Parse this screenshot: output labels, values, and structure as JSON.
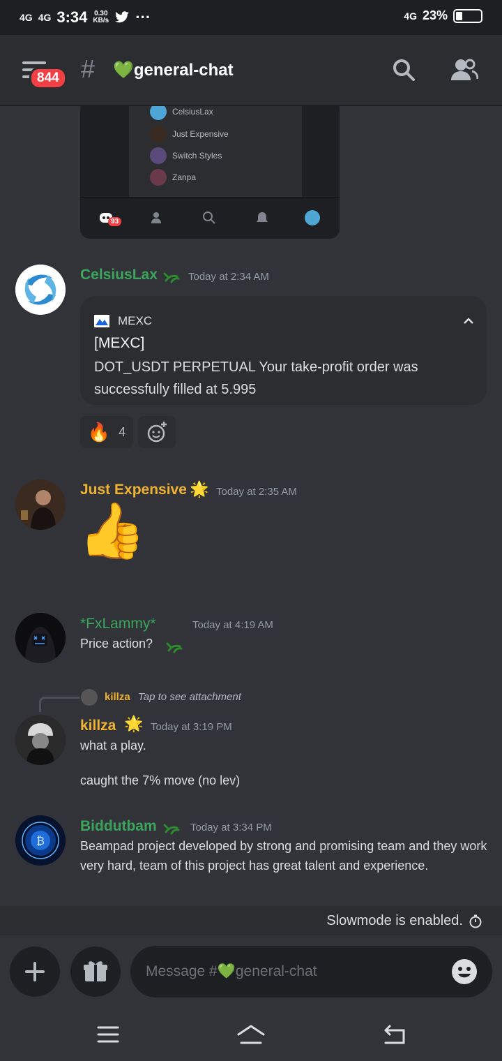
{
  "status_bar": {
    "signal1": "4G",
    "signal2": "4G",
    "time": "3:34",
    "speed_value": "0.30",
    "speed_unit": "KB/s",
    "more": "···",
    "net_right": "4G",
    "battery": "23%"
  },
  "header": {
    "badge_count": "844",
    "hash": "#",
    "channel_name": "💚general-chat"
  },
  "embed_preview": {
    "members": [
      {
        "name": "CelsiusLax",
        "color": "#4ea6d6"
      },
      {
        "name": "Just Expensive",
        "color": "#3a2a22"
      },
      {
        "name": "Switch Styles",
        "color": "#5a4a7a"
      },
      {
        "name": "Zanpa",
        "color": "#6a3a4a"
      }
    ],
    "badge": "93"
  },
  "messages": [
    {
      "username": "CelsiusLax",
      "name_color": "#3ba55c",
      "timestamp": "Today at 2:34 AM",
      "notification": {
        "app": "MEXC",
        "title": "[MEXC]",
        "body": "DOT_USDT PERPETUAL Your take-profit order was successfully filled at 5.995"
      },
      "reaction": {
        "emoji": "🔥",
        "count": "4"
      }
    },
    {
      "username": "Just Expensive",
      "name_color": "#f0b232",
      "badge_emoji": "🌟",
      "timestamp": "Today at 2:35 AM",
      "big_emoji": "👍"
    },
    {
      "username": "*FxLammy*",
      "name_color": "#3ba55c",
      "timestamp": "Today at 4:19 AM",
      "text": "Price action?"
    },
    {
      "reply_user": "killza",
      "reply_text": "Tap to see attachment",
      "username": "killza",
      "name_color": "#f0b232",
      "badge_emoji": "🌟",
      "timestamp": "Today at 3:19 PM",
      "text1": "what a play.",
      "text2": "caught the 7% move (no lev)"
    },
    {
      "username": "Biddutbam",
      "name_color": "#3ba55c",
      "timestamp": "Today at 3:34 PM",
      "text": "Beampad project developed by strong and promising team and they work very hard, team of this project has great talent and experience."
    }
  ],
  "slowmode": "Slowmode is enabled.",
  "composer": {
    "placeholder": "Message #💚general-chat"
  },
  "icons": {
    "menu": "hamburger-menu-icon",
    "search": "search-icon",
    "members": "members-icon",
    "add": "plus-icon",
    "gift": "gift-icon",
    "emoji": "emoji-icon"
  }
}
